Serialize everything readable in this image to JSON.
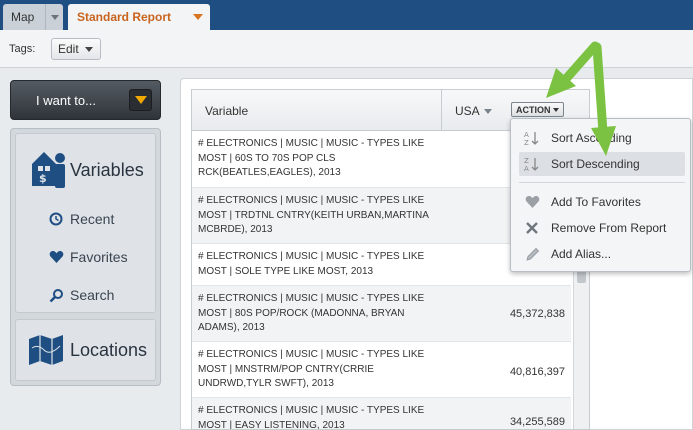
{
  "tabs": [
    {
      "label": "Map"
    },
    {
      "label": "Standard Report"
    }
  ],
  "tags": {
    "label": "Tags:",
    "edit_label": "Edit"
  },
  "left_panel": {
    "i_want_to": "I want to...",
    "variables_title": "Variables",
    "nav": [
      {
        "label": "Recent",
        "icon": "clock-icon"
      },
      {
        "label": "Favorites",
        "icon": "heart-icon"
      },
      {
        "label": "Search",
        "icon": "magnifier-icon"
      }
    ],
    "locations_title": "Locations"
  },
  "table": {
    "col_variable": "Variable",
    "col_location": "USA",
    "action_label": "ACTION",
    "rows": [
      {
        "variable": "# ELECTRONICS | MUSIC | MUSIC - TYPES LIKE MOST | 60S TO 70S POP CLS RCK(BEATLES,EAGLES), 2013",
        "value": ""
      },
      {
        "variable": "# ELECTRONICS | MUSIC | MUSIC - TYPES LIKE MOST | TRDTNL CNTRY(KEITH URBAN,MARTINA MCBRDE), 2013",
        "value": ""
      },
      {
        "variable": "# ELECTRONICS | MUSIC | MUSIC - TYPES LIKE MOST | SOLE TYPE LIKE MOST, 2013",
        "value": ""
      },
      {
        "variable": "# ELECTRONICS | MUSIC | MUSIC - TYPES LIKE MOST | 80S POP/ROCK (MADONNA, BRYAN ADAMS), 2013",
        "value": "45,372,838"
      },
      {
        "variable": "# ELECTRONICS | MUSIC | MUSIC - TYPES LIKE MOST | MNSTRM/POP CNTRY(CRRIE UNDRWD,TYLR SWFT), 2013",
        "value": "40,816,397"
      },
      {
        "variable": "# ELECTRONICS | MUSIC | MUSIC - TYPES LIKE MOST | EASY LISTENING, 2013",
        "value": "34,255,589"
      }
    ]
  },
  "action_menu": {
    "items": [
      {
        "label": "Sort Ascending",
        "icon": "sort-ascending-icon"
      },
      {
        "label": "Sort Descending",
        "icon": "sort-descending-icon"
      },
      {
        "label": "Add To Favorites",
        "icon": "heart-icon"
      },
      {
        "label": "Remove From Report",
        "icon": "x-icon"
      },
      {
        "label": "Add Alias...",
        "icon": "pencil-icon"
      }
    ]
  },
  "colors": {
    "header_bar": "#1f4f82",
    "active_tab_text": "#c9641f",
    "dropdown_accent": "#f1a800",
    "highlight_arrow": "#7cc242",
    "icon_blue": "#1f4f82"
  }
}
